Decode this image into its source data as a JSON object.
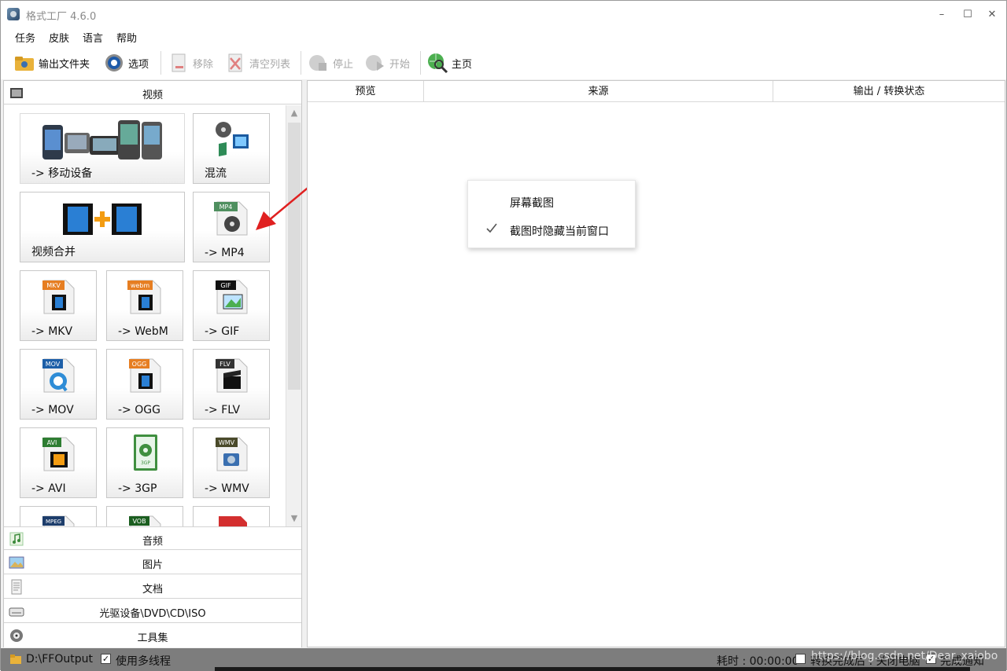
{
  "window": {
    "title": "格式工厂 4.6.0",
    "min_glyph": "–",
    "max_glyph": "☐",
    "close_glyph": "✕"
  },
  "menu": [
    "任务",
    "皮肤",
    "语言",
    "帮助"
  ],
  "toolbar": {
    "output_folder": "输出文件夹",
    "options": "选项",
    "remove": "移除",
    "clear_list": "清空列表",
    "stop": "停止",
    "start": "开始",
    "home": "主页"
  },
  "categories": {
    "video": "视频",
    "audio": "音频",
    "picture": "图片",
    "document": "文档",
    "rom": "光驱设备\\DVD\\CD\\ISO",
    "tools": "工具集"
  },
  "video_tiles": {
    "mobile": "-> 移动设备",
    "mux": "混流",
    "join": "视频合并",
    "mp4": "-> MP4",
    "mkv": "-> MKV",
    "webm": "-> WebM",
    "gif": "-> GIF",
    "mov": "-> MOV",
    "ogg": "-> OGG",
    "flv": "-> FLV",
    "avi": "-> AVI",
    "3gp": "-> 3GP",
    "wmv": "-> WMV"
  },
  "badges": {
    "mp4": "MP4",
    "mkv": "MKV",
    "webm": "webm",
    "gif": "GIF",
    "mov": "MOV",
    "ogg": "OGG",
    "flv": "FLV",
    "avi": "AVI",
    "wmv": "WMV",
    "mpeg": "MPEG",
    "vob": "VOB",
    "3gp": "3GP"
  },
  "columns": {
    "preview": "预览",
    "source": "来源",
    "status": "输出 / 转换状态"
  },
  "context_menu": {
    "screenshot": "屏幕截图",
    "hide_window": "截图时隐藏当前窗口",
    "hide_window_checked": true
  },
  "statusbar": {
    "output_path": "D:\\FFOutput",
    "multithread": "使用多线程",
    "multithread_checked": true,
    "elapsed": "耗时 : 00:00:00",
    "after_convert": "转换完成后 : 关闭电脑",
    "after_convert_checked": false,
    "notify": "完成通知",
    "notify_checked": true,
    "watermark": "https://blog.csdn.net/Dear_xaiobo"
  },
  "colors": {
    "arrow": "#e02020",
    "statusbar": "#7d7d7d"
  }
}
